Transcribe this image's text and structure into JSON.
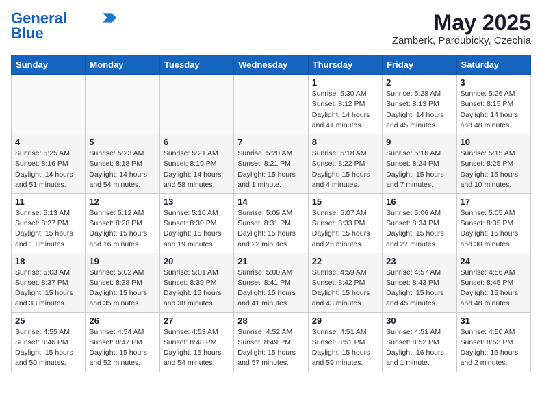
{
  "header": {
    "logo_line1": "General",
    "logo_line2": "Blue",
    "month_year": "May 2025",
    "location": "Zamberk, Pardubicky, Czechia"
  },
  "days_of_week": [
    "Sunday",
    "Monday",
    "Tuesday",
    "Wednesday",
    "Thursday",
    "Friday",
    "Saturday"
  ],
  "weeks": [
    [
      {
        "day": "",
        "info": ""
      },
      {
        "day": "",
        "info": ""
      },
      {
        "day": "",
        "info": ""
      },
      {
        "day": "",
        "info": ""
      },
      {
        "day": "1",
        "info": "Sunrise: 5:30 AM\nSunset: 8:12 PM\nDaylight: 14 hours\nand 41 minutes."
      },
      {
        "day": "2",
        "info": "Sunrise: 5:28 AM\nSunset: 8:13 PM\nDaylight: 14 hours\nand 45 minutes."
      },
      {
        "day": "3",
        "info": "Sunrise: 5:26 AM\nSunset: 8:15 PM\nDaylight: 14 hours\nand 48 minutes."
      }
    ],
    [
      {
        "day": "4",
        "info": "Sunrise: 5:25 AM\nSunset: 8:16 PM\nDaylight: 14 hours\nand 51 minutes."
      },
      {
        "day": "5",
        "info": "Sunrise: 5:23 AM\nSunset: 8:18 PM\nDaylight: 14 hours\nand 54 minutes."
      },
      {
        "day": "6",
        "info": "Sunrise: 5:21 AM\nSunset: 8:19 PM\nDaylight: 14 hours\nand 58 minutes."
      },
      {
        "day": "7",
        "info": "Sunrise: 5:20 AM\nSunset: 8:21 PM\nDaylight: 15 hours\nand 1 minute."
      },
      {
        "day": "8",
        "info": "Sunrise: 5:18 AM\nSunset: 8:22 PM\nDaylight: 15 hours\nand 4 minutes."
      },
      {
        "day": "9",
        "info": "Sunrise: 5:16 AM\nSunset: 8:24 PM\nDaylight: 15 hours\nand 7 minutes."
      },
      {
        "day": "10",
        "info": "Sunrise: 5:15 AM\nSunset: 8:25 PM\nDaylight: 15 hours\nand 10 minutes."
      }
    ],
    [
      {
        "day": "11",
        "info": "Sunrise: 5:13 AM\nSunset: 8:27 PM\nDaylight: 15 hours\nand 13 minutes."
      },
      {
        "day": "12",
        "info": "Sunrise: 5:12 AM\nSunset: 8:28 PM\nDaylight: 15 hours\nand 16 minutes."
      },
      {
        "day": "13",
        "info": "Sunrise: 5:10 AM\nSunset: 8:30 PM\nDaylight: 15 hours\nand 19 minutes."
      },
      {
        "day": "14",
        "info": "Sunrise: 5:09 AM\nSunset: 8:31 PM\nDaylight: 15 hours\nand 22 minutes."
      },
      {
        "day": "15",
        "info": "Sunrise: 5:07 AM\nSunset: 8:33 PM\nDaylight: 15 hours\nand 25 minutes."
      },
      {
        "day": "16",
        "info": "Sunrise: 5:06 AM\nSunset: 8:34 PM\nDaylight: 15 hours\nand 27 minutes."
      },
      {
        "day": "17",
        "info": "Sunrise: 5:05 AM\nSunset: 8:35 PM\nDaylight: 15 hours\nand 30 minutes."
      }
    ],
    [
      {
        "day": "18",
        "info": "Sunrise: 5:03 AM\nSunset: 8:37 PM\nDaylight: 15 hours\nand 33 minutes."
      },
      {
        "day": "19",
        "info": "Sunrise: 5:02 AM\nSunset: 8:38 PM\nDaylight: 15 hours\nand 35 minutes."
      },
      {
        "day": "20",
        "info": "Sunrise: 5:01 AM\nSunset: 8:39 PM\nDaylight: 15 hours\nand 38 minutes."
      },
      {
        "day": "21",
        "info": "Sunrise: 5:00 AM\nSunset: 8:41 PM\nDaylight: 15 hours\nand 41 minutes."
      },
      {
        "day": "22",
        "info": "Sunrise: 4:59 AM\nSunset: 8:42 PM\nDaylight: 15 hours\nand 43 minutes."
      },
      {
        "day": "23",
        "info": "Sunrise: 4:57 AM\nSunset: 8:43 PM\nDaylight: 15 hours\nand 45 minutes."
      },
      {
        "day": "24",
        "info": "Sunrise: 4:56 AM\nSunset: 8:45 PM\nDaylight: 15 hours\nand 48 minutes."
      }
    ],
    [
      {
        "day": "25",
        "info": "Sunrise: 4:55 AM\nSunset: 8:46 PM\nDaylight: 15 hours\nand 50 minutes."
      },
      {
        "day": "26",
        "info": "Sunrise: 4:54 AM\nSunset: 8:47 PM\nDaylight: 15 hours\nand 52 minutes."
      },
      {
        "day": "27",
        "info": "Sunrise: 4:53 AM\nSunset: 8:48 PM\nDaylight: 15 hours\nand 54 minutes."
      },
      {
        "day": "28",
        "info": "Sunrise: 4:52 AM\nSunset: 8:49 PM\nDaylight: 15 hours\nand 57 minutes."
      },
      {
        "day": "29",
        "info": "Sunrise: 4:51 AM\nSunset: 8:51 PM\nDaylight: 15 hours\nand 59 minutes."
      },
      {
        "day": "30",
        "info": "Sunrise: 4:51 AM\nSunset: 8:52 PM\nDaylight: 16 hours\nand 1 minute."
      },
      {
        "day": "31",
        "info": "Sunrise: 4:50 AM\nSunset: 8:53 PM\nDaylight: 16 hours\nand 2 minutes."
      }
    ]
  ]
}
